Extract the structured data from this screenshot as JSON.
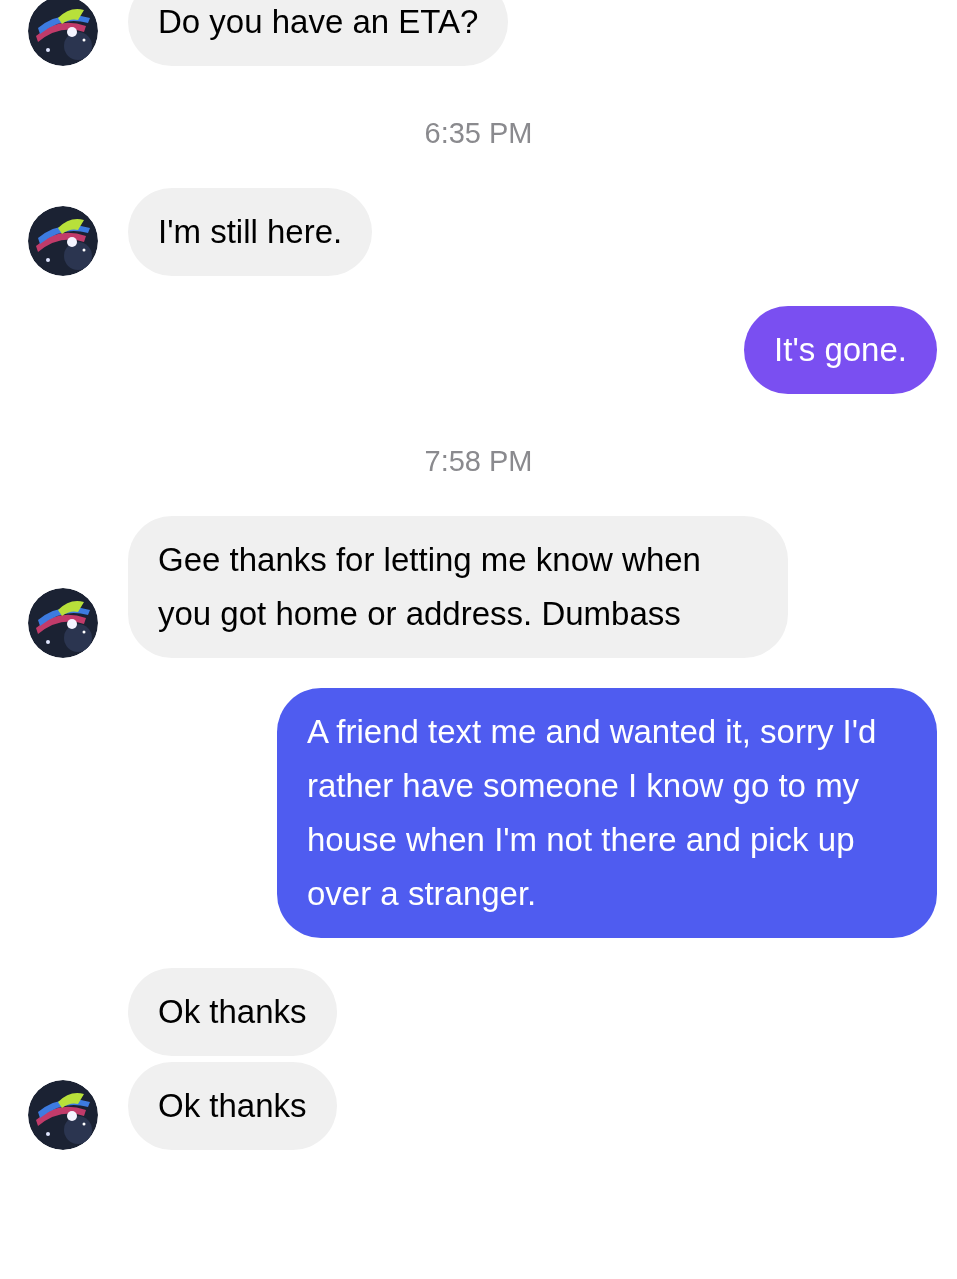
{
  "messages": [
    {
      "kind": "incoming",
      "text": "Do you have an ETA?",
      "avatar": true
    },
    {
      "kind": "time",
      "text": "6:35 PM"
    },
    {
      "kind": "incoming",
      "text": "I'm still here.",
      "avatar": true
    },
    {
      "kind": "outgoing",
      "text": "It's gone.",
      "color": "#7a4ff1"
    },
    {
      "kind": "time",
      "text": "7:58 PM"
    },
    {
      "kind": "incoming",
      "text": "Gee thanks for letting me know when you got home or address. Dumbass",
      "avatar": true
    },
    {
      "kind": "outgoing",
      "text": "A friend text me and wanted it, sorry I'd rather have someone I know go to my house when I'm not there and pick up over a stranger.",
      "color": "#4f5cf0"
    },
    {
      "kind": "incoming",
      "text": "Ok thanks",
      "avatar": false
    },
    {
      "kind": "incoming",
      "text": "Ok thanks",
      "avatar": true
    }
  ]
}
